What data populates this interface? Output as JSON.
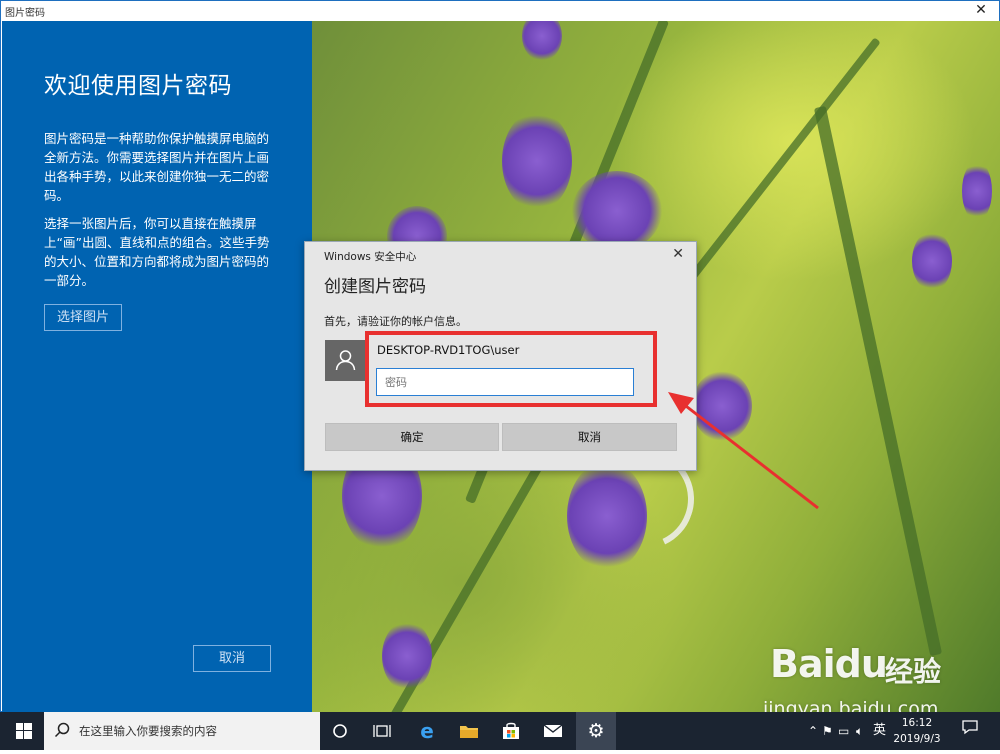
{
  "window": {
    "title": "图片密码",
    "close_glyph": "✕"
  },
  "left_pane": {
    "heading": "欢迎使用图片密码",
    "para1": "图片密码是一种帮助你保护触摸屏电脑的全新方法。你需要选择图片并在图片上画出各种手势，以此来创建你独一无二的密码。",
    "para2": "选择一张图片后，你可以直接在触摸屏上“画”出圆、直线和点的组合。这些手势的大小、位置和方向都将成为图片密码的一部分。",
    "choose_button": "选择图片",
    "cancel_button": "取消"
  },
  "dialog": {
    "caption": "Windows 安全中心",
    "close_glyph": "✕",
    "title": "创建图片密码",
    "subtitle": "首先，请验证你的帐户信息。",
    "username": "DESKTOP-RVD1TOG\\user",
    "password_placeholder": "密码",
    "ok_button": "确定",
    "cancel_button": "取消"
  },
  "taskbar": {
    "search_placeholder": "在这里输入你要搜索的内容",
    "ime_label": "英",
    "time": "16:12",
    "date": "2019/9/3"
  },
  "watermark": {
    "logo": "Bai",
    "logo_du": "du",
    "jingyan": "经验",
    "url": "jingyan.baidu.com"
  },
  "colors": {
    "accent_blue": "#0063b1",
    "highlight_red": "#e8302f",
    "taskbar": "#1b2431"
  }
}
